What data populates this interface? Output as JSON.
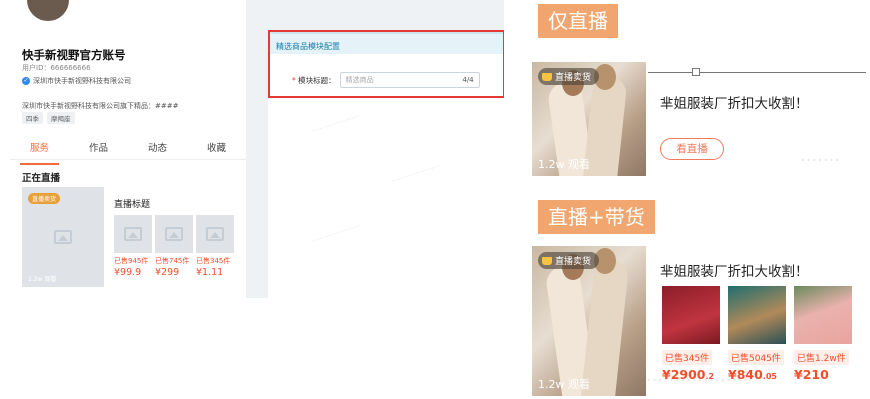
{
  "left_panel": {
    "account_name": "快手新视野官方账号",
    "user_id": "用户ID：666666666",
    "company": "深圳市快手新视野科技有限公司",
    "shop_desc": "深圳市快手新视野科技有限公司旗下精品：####",
    "tags": [
      "四季",
      "摩羯座"
    ],
    "tabs": [
      "服务",
      "作品",
      "动态",
      "收藏"
    ],
    "active_tab": "服务",
    "live_section": "正在直播",
    "live_card": {
      "badge": "直播卖货",
      "watch": "1.2w 观看",
      "title": "直播标题",
      "products": [
        {
          "sold": "已售945件",
          "price": "¥99.9"
        },
        {
          "sold": "已售745件",
          "price": "¥299"
        },
        {
          "sold": "已售345件",
          "price": "¥1.11"
        }
      ]
    },
    "config": {
      "header": "精选商品模块配置",
      "field_label": "模块标题：",
      "required_mark": "*",
      "placeholder": "精选商品",
      "counter": "4/4"
    }
  },
  "section1": {
    "label": "仅直播",
    "badge": "直播卖货",
    "watch": "1.2w 观看",
    "title": "芈姐服装厂折扣大收割！",
    "button": "看直播"
  },
  "section2": {
    "label": "直播+带货",
    "badge": "直播卖货",
    "watch": "1.2w 观看",
    "title": "芈姐服装厂折扣大收割！",
    "products": [
      {
        "sold": "已售345件",
        "price_main": "¥2900",
        "price_dec": ".2"
      },
      {
        "sold": "已售5045件",
        "price_main": "¥840",
        "price_dec": ".05"
      },
      {
        "sold": "已售1.2w件",
        "price_main": "¥210",
        "price_dec": ""
      }
    ]
  },
  "colors": {
    "accent": "#f26b3a",
    "price": "#f04e2b",
    "label_bg": "#f0a66e",
    "highlight_box": "#e53935"
  }
}
